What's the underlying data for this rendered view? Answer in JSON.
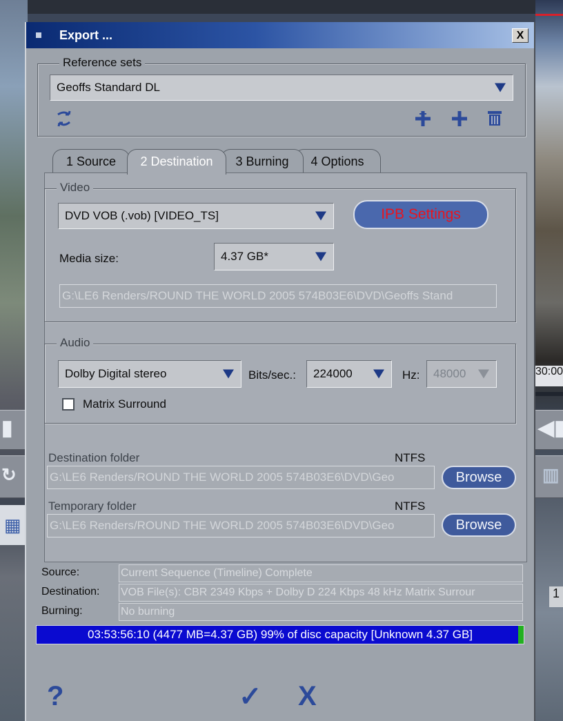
{
  "window": {
    "title": "Export ...",
    "close_label": "X"
  },
  "reference_sets": {
    "legend": "Reference sets",
    "selected": "Geoffs Standard DL",
    "icons": [
      "refresh-icon",
      "add-multiple-icon",
      "add-icon",
      "delete-icon"
    ]
  },
  "tabs": [
    {
      "label": "1 Source",
      "active": false
    },
    {
      "label": "2 Destination",
      "active": true
    },
    {
      "label": "3 Burning",
      "active": false
    },
    {
      "label": "4 Options",
      "active": false
    }
  ],
  "video": {
    "legend": "Video",
    "format": "DVD VOB (.vob) [VIDEO_TS]",
    "ipb_button": "IPB Settings",
    "media_size_label": "Media size:",
    "media_size": "4.37 GB*",
    "path": "G:\\LE6 Renders/ROUND THE WORLD 2005 574B03E6\\DVD\\Geoffs Stand"
  },
  "audio": {
    "legend": "Audio",
    "format": "Dolby Digital stereo",
    "bits_label": "Bits/sec.:",
    "bits": "224000",
    "hz_label": "Hz:",
    "hz": "48000",
    "matrix_label": "Matrix Surround",
    "matrix_checked": false
  },
  "destination_folder": {
    "label": "Destination folder",
    "fs": "NTFS",
    "path": "G:\\LE6 Renders/ROUND THE WORLD 2005 574B03E6\\DVD\\Geo",
    "browse": "Browse"
  },
  "temporary_folder": {
    "label": "Temporary folder",
    "fs": "NTFS",
    "path": "G:\\LE6 Renders/ROUND THE WORLD 2005 574B03E6\\DVD\\Geo",
    "browse": "Browse"
  },
  "summary": {
    "source_label": "Source:",
    "source": "Current Sequence (Timeline) Complete",
    "destination_label": "Destination:",
    "destination": "VOB File(s): CBR 2349 Kbps + Dolby D 224 Kbps 48 kHz Matrix Surrour",
    "burning_label": "Burning:",
    "burning": "No burning"
  },
  "capacity": {
    "text": "03:53:56:10 (4477 MB=4.37 GB) 99% of disc capacity [Unknown 4.37 GB]",
    "fill_percent": 99
  },
  "footer": {
    "help": "?",
    "ok": "✓",
    "cancel": "X"
  },
  "background": {
    "timecode": "30:00",
    "right_number": "1",
    "colors": {
      "accent_red": "#d8202a",
      "title_blue": "#0a2a72",
      "capacity_blue": "#0a0ad0",
      "capacity_green": "#22b020"
    }
  }
}
